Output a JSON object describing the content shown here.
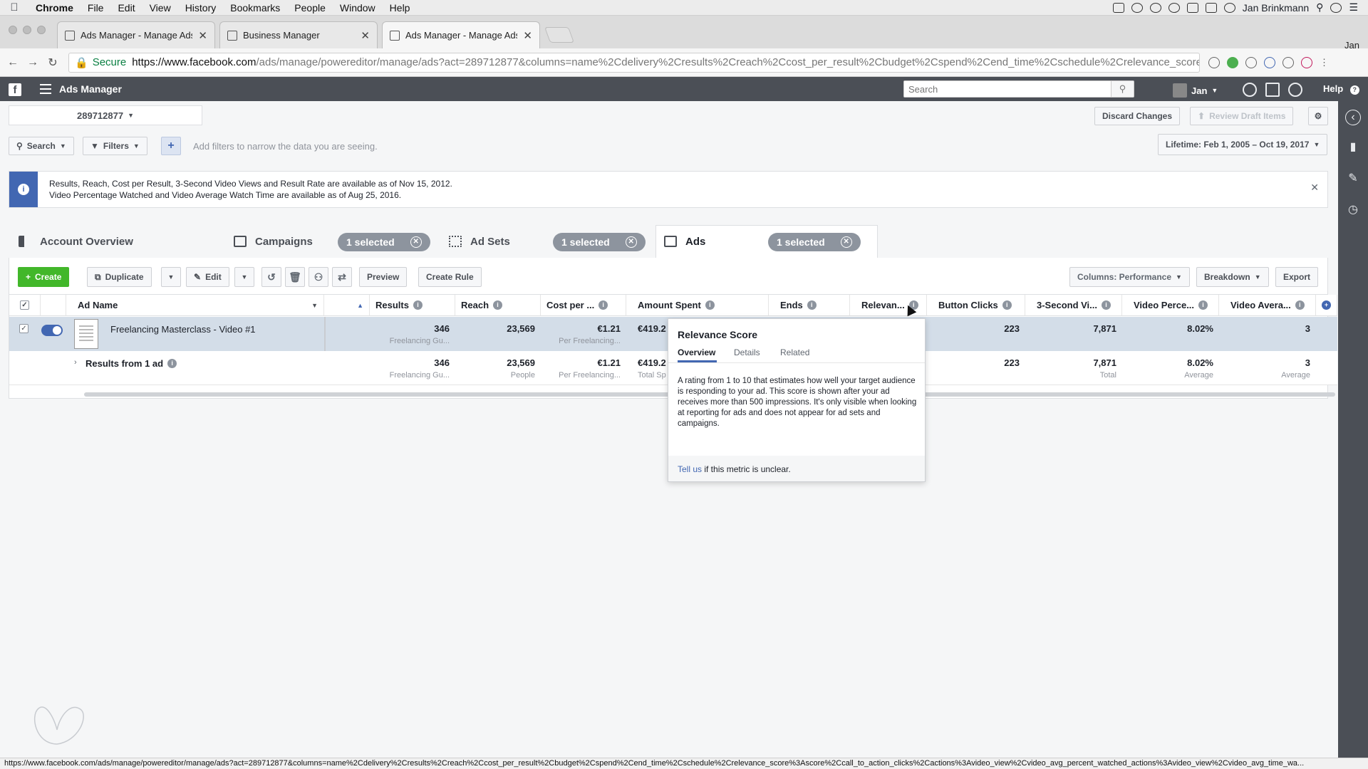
{
  "menubar": {
    "app": "Chrome",
    "items": [
      "File",
      "Edit",
      "View",
      "History",
      "Bookmarks",
      "People",
      "Window",
      "Help"
    ],
    "user": "Jan Brinkmann"
  },
  "browser": {
    "tabs": [
      {
        "title": "Ads Manager - Manage Ads - A"
      },
      {
        "title": "Business Manager"
      },
      {
        "title": "Ads Manager - Manage Ads - A"
      }
    ],
    "profile": "Jan",
    "secure_label": "Secure",
    "url_host": "https://www.facebook.com",
    "url_path": "/ads/manage/powereditor/manage/ads?act=289712877&columns=name%2Cdelivery%2Cresults%2Creach%2Ccost_per_result%2Cbudget%2Cspend%2Cend_time%2Cschedule%2Crelevance_score%3Asc...",
    "status_url": "https://www.facebook.com/ads/manage/powereditor/manage/ads?act=289712877&columns=name%2Cdelivery%2Cresults%2Creach%2Ccost_per_result%2Cbudget%2Cspend%2Cend_time%2Cschedule%2Crelevance_score%3Ascore%2Ccall_to_action_clicks%2Cactions%3Avideo_view%2Cvideo_avg_percent_watched_actions%3Avideo_view%2Cvideo_avg_time_wa..."
  },
  "fb_header": {
    "logo": "f",
    "title": "Ads Manager",
    "search_placeholder": "Search",
    "user": "Jan",
    "help": "Help"
  },
  "account": {
    "id": "289712877"
  },
  "actions": {
    "discard": "Discard Changes",
    "review": "Review Draft Items"
  },
  "filters": {
    "search": "Search",
    "filters": "Filters",
    "plus": "+",
    "hint": "Add filters to narrow the data you are seeing.",
    "date_range": "Lifetime: Feb 1, 2005 – Oct 19, 2017"
  },
  "info": {
    "line1": "Results, Reach, Cost per Result, 3-Second Video Views and Result Rate are available as of Nov 15, 2012.",
    "line2": "Video Percentage Watched and Video Average Watch Time are available as of Aug 25, 2016."
  },
  "levels": {
    "overview": "Account Overview",
    "campaigns": "Campaigns",
    "adsets": "Ad Sets",
    "ads": "Ads",
    "selected": "1 selected"
  },
  "toolbar": {
    "create": "Create",
    "duplicate": "Duplicate",
    "edit": "Edit",
    "preview": "Preview",
    "create_rule": "Create Rule",
    "columns": "Columns: Performance",
    "breakdown": "Breakdown",
    "export": "Export"
  },
  "table": {
    "headers": {
      "name": "Ad Name",
      "results": "Results",
      "reach": "Reach",
      "cost": "Cost per ...",
      "spent": "Amount Spent",
      "ends": "Ends",
      "relevance": "Relevan...",
      "clicks": "Button Clicks",
      "views": "3-Second Vi...",
      "vpct": "Video Perce...",
      "vavg": "Video Avera..."
    },
    "row": {
      "name": "Freelancing Masterclass - Video #1",
      "results": "346",
      "results_sub": "Freelancing Gu...",
      "reach": "23,569",
      "cost": "€1.21",
      "cost_sub": "Per Freelancing...",
      "spent": "€419.2",
      "clicks": "223",
      "views": "7,871",
      "vpct": "8.02%",
      "vavg": "3"
    },
    "summary": {
      "label": "Results from 1 ad",
      "results": "346",
      "results_sub": "Freelancing Gu...",
      "reach": "23,569",
      "reach_sub": "People",
      "cost": "€1.21",
      "cost_sub": "Per Freelancing...",
      "spent": "€419.2",
      "spent_sub": "Total Sp",
      "clicks": "223",
      "views": "7,871",
      "views_sub": "Total",
      "vpct": "8.02%",
      "vpct_sub": "Average",
      "vavg": "3",
      "vavg_sub": "Average"
    }
  },
  "popover": {
    "title": "Relevance Score",
    "tabs": [
      "Overview",
      "Details",
      "Related"
    ],
    "description": "A rating from 1 to 10 that estimates how well your target audience is responding to your ad. This score is shown after your ad receives more than 500 impressions. It's only visible when looking at reporting for ads and does not appear for ad sets and campaigns.",
    "footer_link": "Tell us",
    "footer_text": " if this metric is unclear."
  },
  "colors": {
    "fb_header": "#4b4f56",
    "brand_blue": "#4267b2",
    "create_green": "#42b72a",
    "selected_row": "#d3dde8"
  }
}
